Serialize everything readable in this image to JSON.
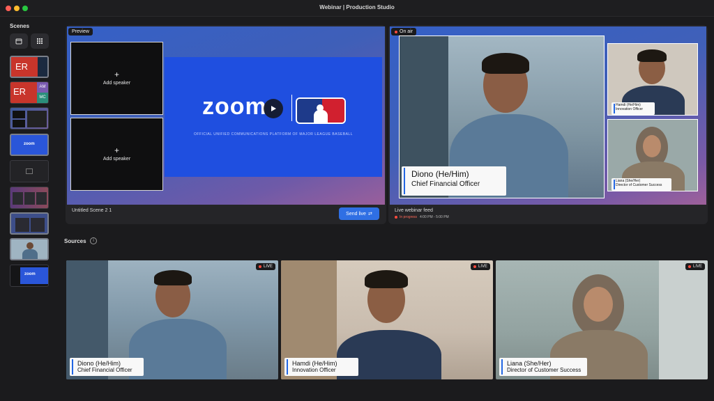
{
  "window": {
    "title": "Webinar | Production Studio"
  },
  "sidebar": {
    "title": "Scenes",
    "thumbs": [
      {
        "initials": "ER"
      },
      {
        "initials": "ER",
        "sub1": "AM",
        "sub2": "MC"
      },
      {},
      {
        "logo": "zoom"
      },
      {},
      {},
      {},
      {},
      {
        "logo": "zoom"
      }
    ]
  },
  "preview": {
    "badge": "Preview",
    "slot1_plus": "+",
    "slot1_label": "Add speaker",
    "slot2_plus": "+",
    "slot2_label": "Add speaker",
    "banner_word": "zoom",
    "banner_tagline": "OFFICIAL UNIFIED COMMUNICATIONS PLATFORM OF MAJOR LEAGUE BASEBALL",
    "scene_name": "Untitled Scene 2 1",
    "send_live": "Send live",
    "send_icon": "⇄"
  },
  "onair": {
    "badge": "On air",
    "main_name": "Diono (He/Him)",
    "main_title": "Chief Financial Officer",
    "tile1_name": "Hamdi (He/Him)",
    "tile1_title": "Innovation Officer",
    "tile2_name": "Liana (She/Her)",
    "tile2_title": "Director of Customer Success",
    "feed_label": "Live webinar feed",
    "status": "In progress",
    "time": "4:00 PM - 5:00 PM"
  },
  "sources": {
    "title": "Sources",
    "info_icon": "i",
    "items": [
      {
        "live": "LIVE",
        "name": "Diono (He/Him)",
        "title": "Chief Financial Officer"
      },
      {
        "live": "LIVE",
        "name": "Hamdi (He/Him)",
        "title": "Innovation Officer"
      },
      {
        "live": "LIVE",
        "name": "Liana (She/Her)",
        "title": "Director of Customer Success"
      }
    ]
  },
  "colors": {
    "accent": "#2f6fe4",
    "live_red": "#ff4a3d",
    "banner_blue": "#1f4fe0"
  }
}
